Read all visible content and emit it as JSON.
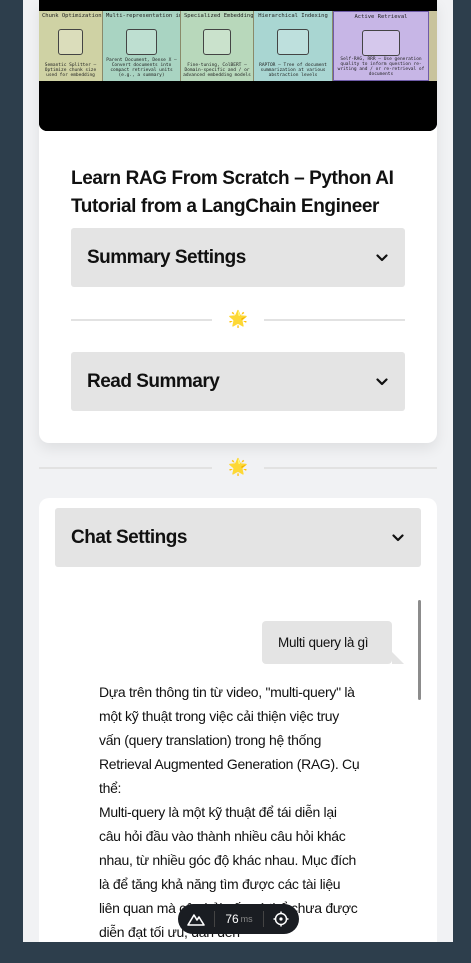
{
  "video": {
    "title": "Learn RAG From Scratch – Python AI Tutorial from a LangChain Engineer",
    "thumbnail_panels": [
      {
        "title": "Chunk Optimization",
        "footer": "Semantic Splitter — Optimize chunk size used for embedding"
      },
      {
        "title": "Multi-representation indexing",
        "footer": "Parent Document, Dense X — Convert documents into compact retrieval units (e.g., a summary)"
      },
      {
        "title": "Specialized Embeddings",
        "footer": "Fine-tuning, ColBERT — Domain-specific and / or advanced embedding models"
      },
      {
        "title": "Hierarchical Indexing",
        "footer": "RAPTOR — Tree of document summarization at various abstraction levels"
      },
      {
        "title": "Active Retrieval",
        "footer": "Self-RAG, RRR — Use generation quality to inform question re-writing and / or re-retrieval of documents"
      }
    ]
  },
  "accordions": {
    "summary_settings": "Summary Settings",
    "read_summary": "Read Summary",
    "chat_settings": "Chat Settings"
  },
  "divider_icon": "🌟",
  "chat": {
    "user_message": "Multi query là gì",
    "bot_paragraph_1": "Dựa trên thông tin từ video, \"multi-query\" là một kỹ thuật trong việc cải thiện việc truy vấn (query translation) trong hệ thống Retrieval Augmented Generation (RAG). Cụ thể:",
    "bot_paragraph_2": "Multi-query là một kỹ thuật để tái diễn lại câu hỏi đầu vào thành nhiều câu hỏi khác nhau, từ nhiều góc độ khác nhau. Mục đích là để tăng khả năng tìm được các tài liệu liên quan mà câu hỏi gốc có thể chưa được diễn đạt tối ưu, dẫn đến"
  },
  "perf": {
    "value": "76",
    "unit": "ms",
    "left_icon": "mountain-logo-icon",
    "right_icon": "crosshair-icon"
  },
  "colors": {
    "background": "#2d3e4c",
    "page": "#f1f2f4",
    "accordion": "#e4e4e4",
    "pill": "#1a1d22"
  }
}
